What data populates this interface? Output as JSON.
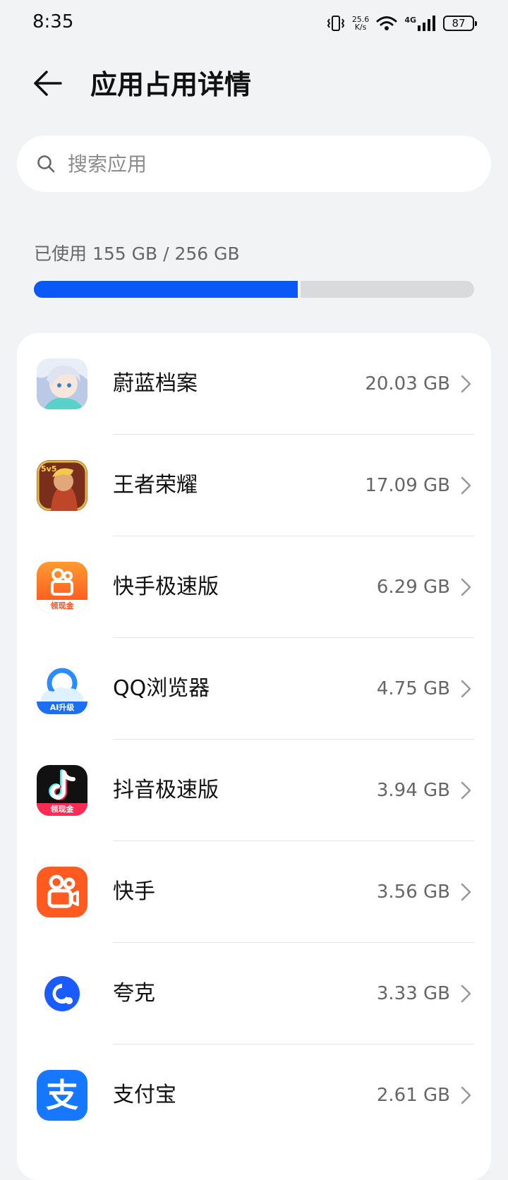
{
  "status_bar": {
    "time": "8:35",
    "net_speed_value": "25.6",
    "net_speed_unit": "K/s",
    "network_type": "4G",
    "battery": "87"
  },
  "header": {
    "title": "应用占用详情"
  },
  "search": {
    "placeholder": "搜索应用"
  },
  "storage": {
    "usage_label": "已使用 155 GB / 256 GB",
    "used_fraction": 0.605
  },
  "apps": [
    {
      "name": "蔚蓝档案",
      "size": "20.03 GB",
      "icon": "blue-archive-app-icon"
    },
    {
      "name": "王者荣耀",
      "size": "17.09 GB",
      "icon": "honor-of-kings-app-icon"
    },
    {
      "name": "快手极速版",
      "size": "6.29 GB",
      "icon": "kuaishou-lite-app-icon",
      "badge": "领现金"
    },
    {
      "name": "QQ浏览器",
      "size": "4.75 GB",
      "icon": "qq-browser-app-icon",
      "badge": "AI升级"
    },
    {
      "name": "抖音极速版",
      "size": "3.94 GB",
      "icon": "douyin-lite-app-icon",
      "badge": "领现金"
    },
    {
      "name": "快手",
      "size": "3.56 GB",
      "icon": "kuaishou-app-icon"
    },
    {
      "name": "夸克",
      "size": "3.33 GB",
      "icon": "quark-app-icon"
    },
    {
      "name": "支付宝",
      "size": "2.61 GB",
      "icon": "alipay-app-icon",
      "glyph": "支"
    }
  ],
  "colors": {
    "accent": "#0a59f7",
    "background": "#f1f3f5",
    "card": "#ffffff"
  }
}
